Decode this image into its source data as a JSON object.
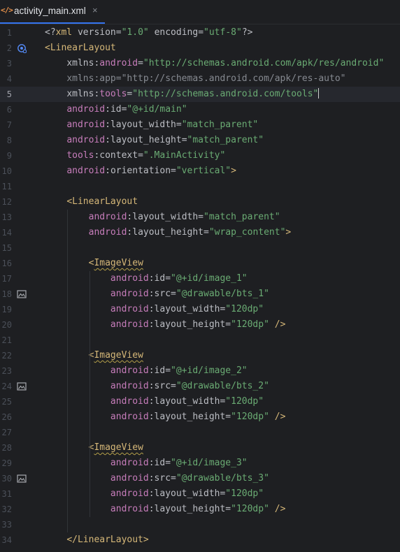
{
  "tab": {
    "icon": "xml-file-icon",
    "title": "activity_main.xml",
    "close": "×"
  },
  "lines": [
    {
      "n": "1",
      "tokens": [
        [
          "pun",
          "<?"
        ],
        [
          "tag",
          "xml "
        ],
        [
          "attr",
          "version"
        ],
        [
          "pun",
          "="
        ],
        [
          "str",
          "\"1.0\""
        ],
        [
          "pun",
          " "
        ],
        [
          "attr",
          "encoding"
        ],
        [
          "pun",
          "="
        ],
        [
          "str",
          "\"utf-8\""
        ],
        [
          "pun",
          "?>"
        ]
      ]
    },
    {
      "n": "2",
      "icon": "layout-preview-icon",
      "tokens": [
        [
          "tag",
          "<LinearLayout"
        ]
      ]
    },
    {
      "n": "3",
      "tokens": [
        [
          "pun",
          "    "
        ],
        [
          "attr",
          "xmlns:"
        ],
        [
          "ns",
          "android"
        ],
        [
          "pun",
          "="
        ],
        [
          "str",
          "\"http://schemas.android.com/apk/res/android\""
        ]
      ]
    },
    {
      "n": "4",
      "tokens": [
        [
          "pun",
          "    "
        ],
        [
          "dim",
          "xmlns:app=\"http://schemas.android.com/apk/res-auto\""
        ]
      ]
    },
    {
      "n": "5",
      "caret": true,
      "tokens": [
        [
          "pun",
          "    "
        ],
        [
          "attr",
          "xmlns:"
        ],
        [
          "ns",
          "tools"
        ],
        [
          "pun",
          "="
        ],
        [
          "str",
          "\"http://schemas.android.com/tools\""
        ]
      ]
    },
    {
      "n": "6",
      "tokens": [
        [
          "pun",
          "    "
        ],
        [
          "ns",
          "android"
        ],
        [
          "pun",
          ":"
        ],
        [
          "attr",
          "id"
        ],
        [
          "pun",
          "="
        ],
        [
          "str",
          "\"@+id/main\""
        ]
      ]
    },
    {
      "n": "7",
      "tokens": [
        [
          "pun",
          "    "
        ],
        [
          "ns",
          "android"
        ],
        [
          "pun",
          ":"
        ],
        [
          "attr",
          "layout_width"
        ],
        [
          "pun",
          "="
        ],
        [
          "str",
          "\"match_parent\""
        ]
      ]
    },
    {
      "n": "8",
      "tokens": [
        [
          "pun",
          "    "
        ],
        [
          "ns",
          "android"
        ],
        [
          "pun",
          ":"
        ],
        [
          "attr",
          "layout_height"
        ],
        [
          "pun",
          "="
        ],
        [
          "str",
          "\"match_parent\""
        ]
      ]
    },
    {
      "n": "9",
      "tokens": [
        [
          "pun",
          "    "
        ],
        [
          "ns",
          "tools"
        ],
        [
          "pun",
          ":"
        ],
        [
          "attr",
          "context"
        ],
        [
          "pun",
          "="
        ],
        [
          "str",
          "\".MainActivity\""
        ]
      ]
    },
    {
      "n": "10",
      "tokens": [
        [
          "pun",
          "    "
        ],
        [
          "ns",
          "android"
        ],
        [
          "pun",
          ":"
        ],
        [
          "attr",
          "orientation"
        ],
        [
          "pun",
          "="
        ],
        [
          "str",
          "\"vertical\""
        ],
        [
          "tag",
          ">"
        ]
      ]
    },
    {
      "n": "11",
      "tokens": []
    },
    {
      "n": "12",
      "tokens": [
        [
          "pun",
          "    "
        ],
        [
          "tag",
          "<LinearLayout"
        ]
      ]
    },
    {
      "n": "13",
      "tokens": [
        [
          "pun",
          "        "
        ],
        [
          "ns",
          "android"
        ],
        [
          "pun",
          ":"
        ],
        [
          "attr",
          "layout_width"
        ],
        [
          "pun",
          "="
        ],
        [
          "str",
          "\"match_parent\""
        ]
      ]
    },
    {
      "n": "14",
      "tokens": [
        [
          "pun",
          "        "
        ],
        [
          "ns",
          "android"
        ],
        [
          "pun",
          ":"
        ],
        [
          "attr",
          "layout_height"
        ],
        [
          "pun",
          "="
        ],
        [
          "str",
          "\"wrap_content\""
        ],
        [
          "tag",
          ">"
        ]
      ]
    },
    {
      "n": "15",
      "tokens": []
    },
    {
      "n": "16",
      "tokens": [
        [
          "pun",
          "        "
        ],
        [
          "tag",
          "<"
        ],
        [
          "sq",
          "ImageView"
        ]
      ]
    },
    {
      "n": "17",
      "tokens": [
        [
          "pun",
          "            "
        ],
        [
          "ns",
          "android"
        ],
        [
          "pun",
          ":"
        ],
        [
          "attr",
          "id"
        ],
        [
          "pun",
          "="
        ],
        [
          "str",
          "\"@+id/image_1\""
        ]
      ]
    },
    {
      "n": "18",
      "icon": "image-icon",
      "tokens": [
        [
          "pun",
          "            "
        ],
        [
          "ns",
          "android"
        ],
        [
          "pun",
          ":"
        ],
        [
          "attr",
          "src"
        ],
        [
          "pun",
          "="
        ],
        [
          "str",
          "\"@drawable/bts_1\""
        ]
      ]
    },
    {
      "n": "19",
      "tokens": [
        [
          "pun",
          "            "
        ],
        [
          "ns",
          "android"
        ],
        [
          "pun",
          ":"
        ],
        [
          "attr",
          "layout_width"
        ],
        [
          "pun",
          "="
        ],
        [
          "str",
          "\"120dp\""
        ]
      ]
    },
    {
      "n": "20",
      "tokens": [
        [
          "pun",
          "            "
        ],
        [
          "ns",
          "android"
        ],
        [
          "pun",
          ":"
        ],
        [
          "attr",
          "layout_height"
        ],
        [
          "pun",
          "="
        ],
        [
          "str",
          "\"120dp\""
        ],
        [
          "pun",
          " "
        ],
        [
          "tag",
          "/>"
        ]
      ]
    },
    {
      "n": "21",
      "tokens": []
    },
    {
      "n": "22",
      "tokens": [
        [
          "pun",
          "        "
        ],
        [
          "tag",
          "<"
        ],
        [
          "sq",
          "ImageView"
        ]
      ]
    },
    {
      "n": "23",
      "tokens": [
        [
          "pun",
          "            "
        ],
        [
          "ns",
          "android"
        ],
        [
          "pun",
          ":"
        ],
        [
          "attr",
          "id"
        ],
        [
          "pun",
          "="
        ],
        [
          "str",
          "\"@+id/image_2\""
        ]
      ]
    },
    {
      "n": "24",
      "icon": "image-icon",
      "tokens": [
        [
          "pun",
          "            "
        ],
        [
          "ns",
          "android"
        ],
        [
          "pun",
          ":"
        ],
        [
          "attr",
          "src"
        ],
        [
          "pun",
          "="
        ],
        [
          "str",
          "\"@drawable/bts_2\""
        ]
      ]
    },
    {
      "n": "25",
      "tokens": [
        [
          "pun",
          "            "
        ],
        [
          "ns",
          "android"
        ],
        [
          "pun",
          ":"
        ],
        [
          "attr",
          "layout_width"
        ],
        [
          "pun",
          "="
        ],
        [
          "str",
          "\"120dp\""
        ]
      ]
    },
    {
      "n": "26",
      "tokens": [
        [
          "pun",
          "            "
        ],
        [
          "ns",
          "android"
        ],
        [
          "pun",
          ":"
        ],
        [
          "attr",
          "layout_height"
        ],
        [
          "pun",
          "="
        ],
        [
          "str",
          "\"120dp\""
        ],
        [
          "pun",
          " "
        ],
        [
          "tag",
          "/>"
        ]
      ]
    },
    {
      "n": "27",
      "tokens": []
    },
    {
      "n": "28",
      "tokens": [
        [
          "pun",
          "        "
        ],
        [
          "tag",
          "<"
        ],
        [
          "sq",
          "ImageView"
        ]
      ]
    },
    {
      "n": "29",
      "tokens": [
        [
          "pun",
          "            "
        ],
        [
          "ns",
          "android"
        ],
        [
          "pun",
          ":"
        ],
        [
          "attr",
          "id"
        ],
        [
          "pun",
          "="
        ],
        [
          "str",
          "\"@+id/image_3\""
        ]
      ]
    },
    {
      "n": "30",
      "icon": "image-icon",
      "tokens": [
        [
          "pun",
          "            "
        ],
        [
          "ns",
          "android"
        ],
        [
          "pun",
          ":"
        ],
        [
          "attr",
          "src"
        ],
        [
          "pun",
          "="
        ],
        [
          "str",
          "\"@drawable/bts_3\""
        ]
      ]
    },
    {
      "n": "31",
      "tokens": [
        [
          "pun",
          "            "
        ],
        [
          "ns",
          "android"
        ],
        [
          "pun",
          ":"
        ],
        [
          "attr",
          "layout_width"
        ],
        [
          "pun",
          "="
        ],
        [
          "str",
          "\"120dp\""
        ]
      ]
    },
    {
      "n": "32",
      "tokens": [
        [
          "pun",
          "            "
        ],
        [
          "ns",
          "android"
        ],
        [
          "pun",
          ":"
        ],
        [
          "attr",
          "layout_height"
        ],
        [
          "pun",
          "="
        ],
        [
          "str",
          "\"120dp\""
        ],
        [
          "pun",
          " "
        ],
        [
          "tag",
          "/>"
        ]
      ]
    },
    {
      "n": "33",
      "tokens": []
    },
    {
      "n": "34",
      "tokens": [
        [
          "pun",
          "    "
        ],
        [
          "tag",
          "</LinearLayout>"
        ]
      ]
    }
  ]
}
